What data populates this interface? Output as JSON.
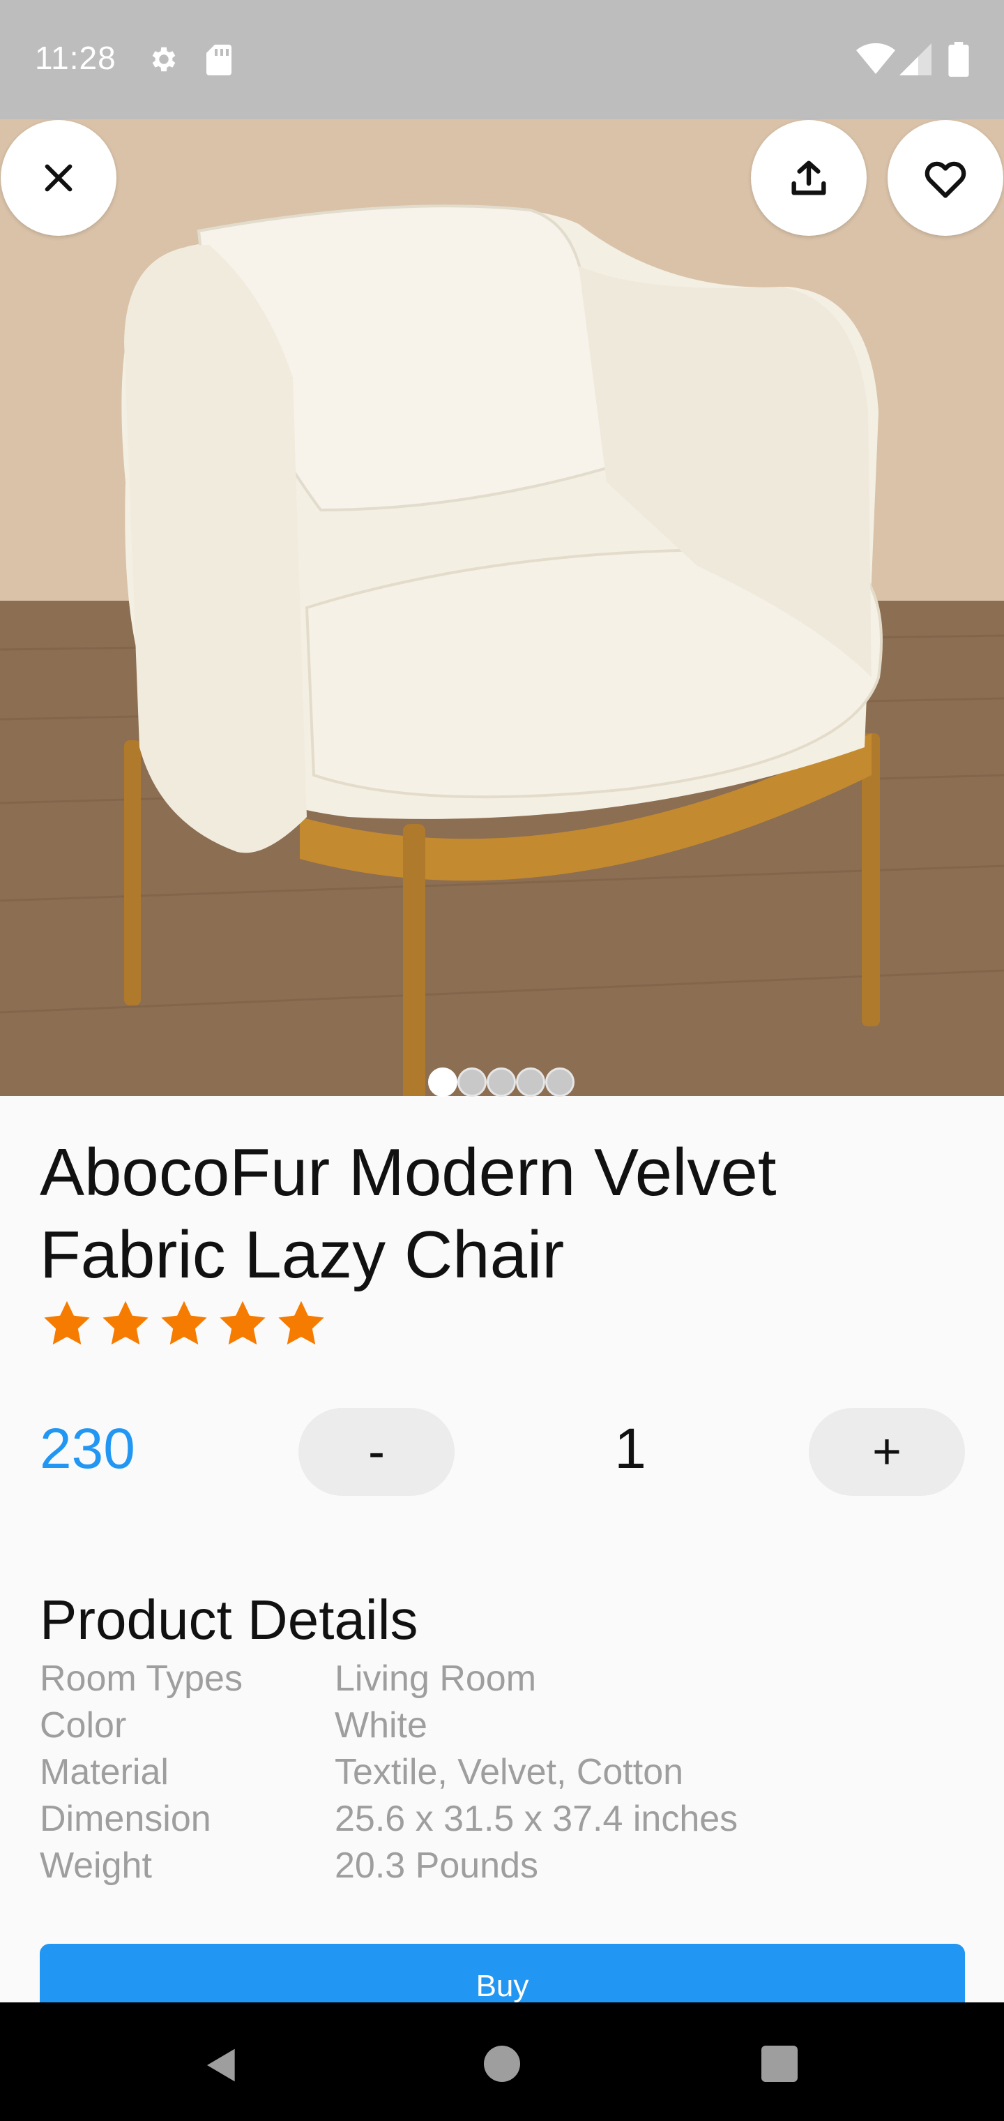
{
  "status_bar": {
    "time": "11:28",
    "icons": [
      "gear-icon",
      "sd-card-icon",
      "wifi-icon",
      "signal-icon",
      "battery-icon"
    ]
  },
  "hero": {
    "image_description": "white fabric armchair with gold metal legs",
    "image_count": 5,
    "active_index": 0,
    "buttons": {
      "close_icon": "close-icon",
      "share_icon": "share-icon",
      "favorite_icon": "heart-icon"
    }
  },
  "product": {
    "title": "AbocoFur Modern Velvet Fabric Lazy Chair",
    "rating": 5,
    "rating_max": 5,
    "price": "230",
    "quantity": "1",
    "minus_label": "-",
    "plus_label": "+"
  },
  "details": {
    "section_title": "Product Details",
    "rows": [
      {
        "label": "Room Types",
        "value": "Living Room"
      },
      {
        "label": "Color",
        "value": "White"
      },
      {
        "label": "Material",
        "value": "Textile, Velvet, Cotton"
      },
      {
        "label": "Dimension",
        "value": "25.6 x 31.5 x 37.4 inches"
      },
      {
        "label": "Weight",
        "value": "20.3 Pounds"
      }
    ]
  },
  "actions": {
    "buy_label": "Buy"
  },
  "colors": {
    "accent": "#2196f3",
    "star": "#f57c00",
    "detail_text": "#9e9e9e",
    "status_bar": "#bdbdbd"
  },
  "nav_bar": {
    "icons": [
      "back-icon",
      "home-icon",
      "recents-icon"
    ]
  }
}
